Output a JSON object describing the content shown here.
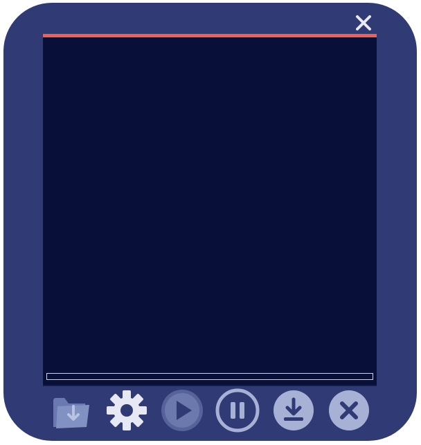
{
  "player": {
    "accent_color": "#f0604e",
    "frame_color": "#303a74",
    "screen_color": "#08103a",
    "progress_fraction": 0
  },
  "controls": [
    {
      "name": "open-folder",
      "icon": "folder-download-icon",
      "state": "disabled"
    },
    {
      "name": "settings",
      "icon": "gear-icon",
      "state": "enabled"
    },
    {
      "name": "play",
      "icon": "play-icon",
      "state": "disabled"
    },
    {
      "name": "pause",
      "icon": "pause-icon",
      "state": "enabled"
    },
    {
      "name": "download",
      "icon": "download-icon",
      "state": "enabled"
    },
    {
      "name": "stop",
      "icon": "close-icon",
      "state": "enabled"
    }
  ],
  "window": {
    "close_icon": "close-icon"
  }
}
